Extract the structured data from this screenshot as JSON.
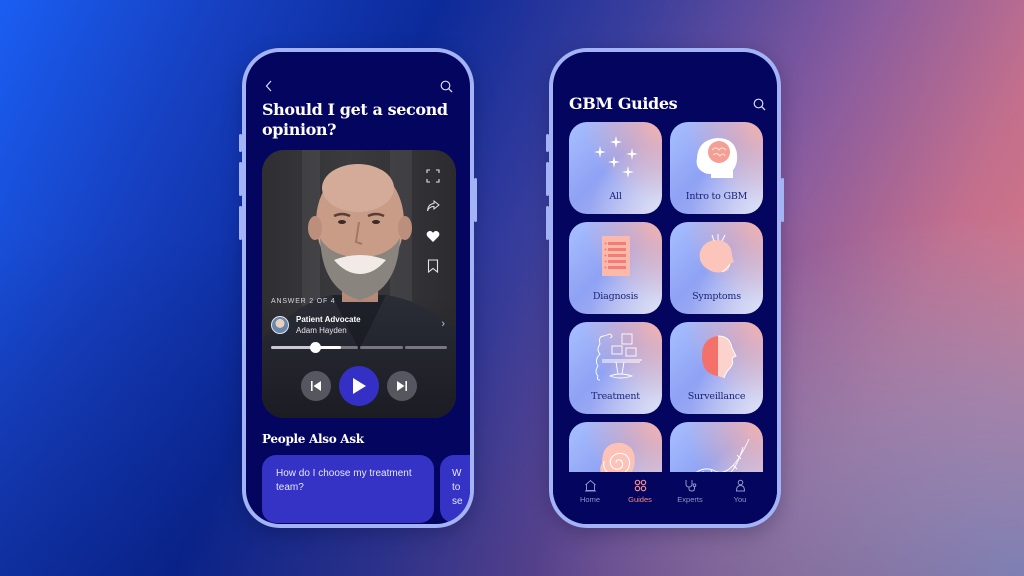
{
  "colors": {
    "phone_bg": "#03055e",
    "phone_frame": "#a3b3f5",
    "accent_blue": "#3532c6",
    "active_tab": "#f08a8a",
    "tile_label": "#1d2478"
  },
  "left_phone": {
    "header": {
      "back_icon": "chevron-left-icon",
      "search_icon": "search-icon"
    },
    "question_title": "Should I get a second opinion?",
    "video": {
      "side_actions": [
        {
          "name": "fullscreen",
          "icon": "fullscreen-icon"
        },
        {
          "name": "share",
          "icon": "share-icon"
        },
        {
          "name": "like",
          "icon": "heart-icon"
        },
        {
          "name": "bookmark",
          "icon": "bookmark-icon"
        }
      ],
      "answer_label": "ANSWER 2 OF 4",
      "answer_index": 2,
      "answer_total": 4,
      "speaker_role": "Patient Advocate",
      "speaker_name": "Adam Hayden",
      "current_segment_progress": 0.6,
      "controls": {
        "previous_icon": "skip-previous-icon",
        "play_icon": "play-icon",
        "next_icon": "skip-next-icon"
      }
    },
    "people_also_ask": {
      "title": "People Also Ask",
      "cards": [
        {
          "text": "How do I choose my treatment team?"
        },
        {
          "text": "W\nto\nse"
        }
      ]
    }
  },
  "right_phone": {
    "title": "GBM Guides",
    "search_icon": "search-icon",
    "tiles": [
      {
        "label": "All",
        "icon": "stars-icon"
      },
      {
        "label": "Intro to GBM",
        "icon": "head-brain-icon"
      },
      {
        "label": "Diagnosis",
        "icon": "clipboard-list-icon"
      },
      {
        "label": "Symptoms",
        "icon": "head-ache-icon"
      },
      {
        "label": "Treatment",
        "icon": "treatment-room-icon"
      },
      {
        "label": "Surveillance",
        "icon": "face-profile-icon"
      },
      {
        "label": "",
        "icon": "spiral-cell-icon"
      },
      {
        "label": "",
        "icon": "dna-icon"
      }
    ],
    "tabbar": {
      "active": "Guides",
      "items": [
        {
          "label": "Home",
          "icon": "home-icon"
        },
        {
          "label": "Guides",
          "icon": "grid-icon"
        },
        {
          "label": "Experts",
          "icon": "stethoscope-icon"
        },
        {
          "label": "You",
          "icon": "person-icon"
        }
      ]
    }
  }
}
